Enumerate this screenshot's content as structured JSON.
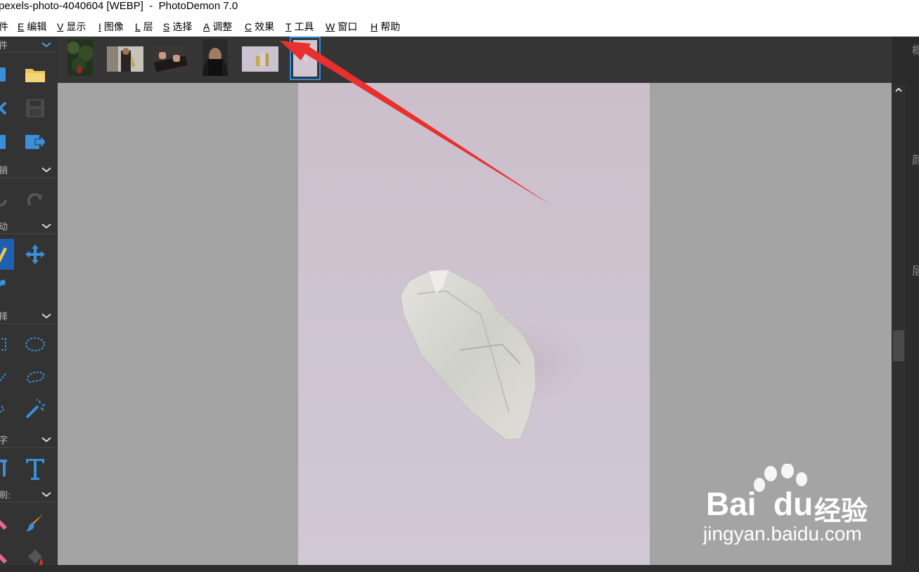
{
  "window": {
    "title": "pexels-photo-4040604 [WEBP]  -  PhotoDemon 7.0"
  },
  "menu": [
    {
      "key": "",
      "label": "件"
    },
    {
      "key": "E",
      "label": "编辑"
    },
    {
      "key": "V",
      "label": "显示"
    },
    {
      "key": "I",
      "label": "图像"
    },
    {
      "key": "L",
      "label": "层"
    },
    {
      "key": "S",
      "label": "选择"
    },
    {
      "key": "A",
      "label": "调整"
    },
    {
      "key": "C",
      "label": "效果"
    },
    {
      "key": "T",
      "label": "工具"
    },
    {
      "key": "W",
      "label": "窗口"
    },
    {
      "key": "H",
      "label": "帮助"
    }
  ],
  "toolbox": {
    "sections": [
      {
        "label": "件"
      },
      {
        "label": "销"
      },
      {
        "label": "动"
      },
      {
        "label": "择"
      },
      {
        "label": "字"
      },
      {
        "label": "刷:"
      }
    ]
  },
  "thumbnails": [
    {
      "name": "forest-person"
    },
    {
      "name": "saxophone-player"
    },
    {
      "name": "keyboard-hands"
    },
    {
      "name": "hooded-face"
    },
    {
      "name": "bottles"
    },
    {
      "name": "crystal",
      "selected": true
    }
  ],
  "right_panel": {
    "chars": [
      "概",
      "颜",
      "层"
    ]
  },
  "watermark": {
    "brand": "Bai",
    "brand2": "du",
    "cn": "经验",
    "url": "jingyan.baidu.com"
  },
  "colors": {
    "accent": "#2b8be0",
    "arrow": "#e8302e",
    "icon_blue": "#3a8fd8"
  }
}
